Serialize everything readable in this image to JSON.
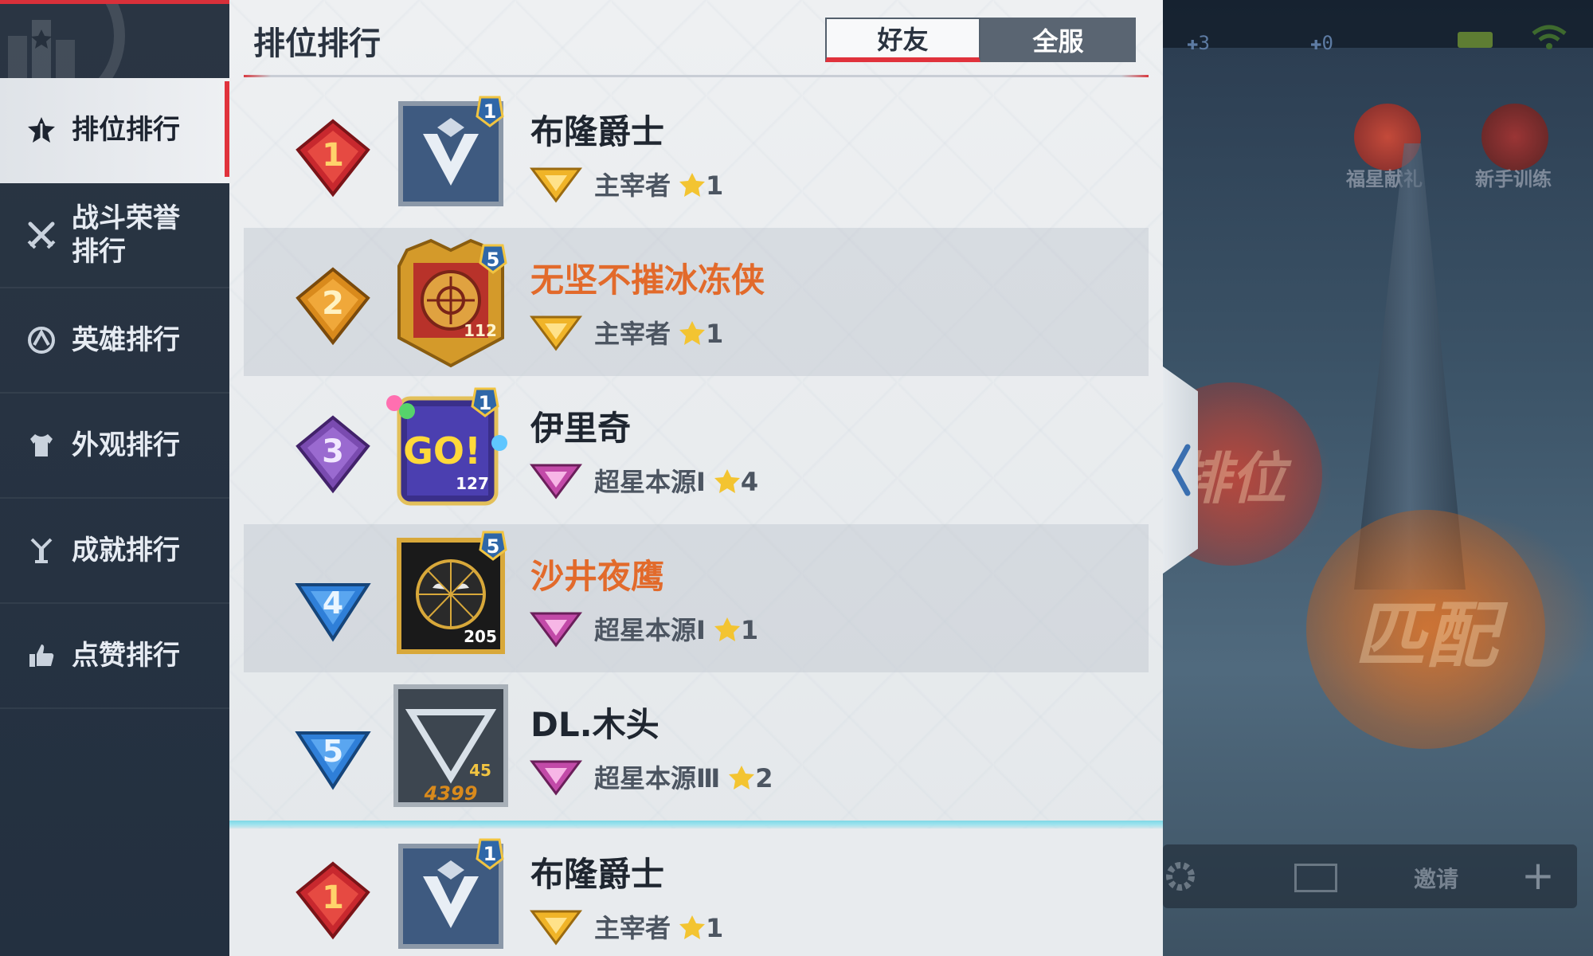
{
  "sidebar": {
    "items": [
      {
        "label": "排位排行",
        "icon": "star-rank-icon",
        "active": true
      },
      {
        "label": "战斗荣誉排行",
        "icon": "crossed-swords-icon",
        "active": false
      },
      {
        "label": "英雄排行",
        "icon": "hero-emblem-icon",
        "active": false
      },
      {
        "label": "外观排行",
        "icon": "shirt-icon",
        "active": false
      },
      {
        "label": "成就排行",
        "icon": "trophy-icon",
        "active": false
      },
      {
        "label": "点赞排行",
        "icon": "thumbs-up-icon",
        "active": false
      }
    ]
  },
  "panel": {
    "title": "排位排行",
    "tabs": [
      {
        "label": "好友",
        "active": true
      },
      {
        "label": "全服",
        "active": false
      }
    ]
  },
  "rankings": [
    {
      "rank": "1",
      "name": "布隆爵士",
      "name_highlight": false,
      "tier": "主宰者",
      "stars": "1",
      "avatar_badge": "1",
      "avatar_level": "",
      "avatar_style": "silver-v"
    },
    {
      "rank": "2",
      "name": "无坚不摧冰冻侠",
      "name_highlight": true,
      "tier": "主宰者",
      "stars": "1",
      "avatar_badge": "5",
      "avatar_level": "112",
      "avatar_style": "gold-crest"
    },
    {
      "rank": "3",
      "name": "伊里奇",
      "name_highlight": false,
      "tier": "超星本源Ⅰ",
      "stars": "4",
      "avatar_badge": "1",
      "avatar_level": "127",
      "avatar_style": "go-balloons"
    },
    {
      "rank": "4",
      "name": "沙井夜鹰",
      "name_highlight": true,
      "tier": "超星本源Ⅰ",
      "stars": "1",
      "avatar_badge": "5",
      "avatar_level": "205",
      "avatar_style": "spider-gold"
    },
    {
      "rank": "5",
      "name": "DL.木头",
      "name_highlight": false,
      "tier": "超星本源Ⅲ",
      "stars": "2",
      "avatar_badge": "",
      "avatar_level": "45",
      "avatar_style": "silver-triangle",
      "avatar_caption": "4399"
    }
  ],
  "self_row": {
    "rank": "1",
    "name": "布隆爵士",
    "tier": "主宰者",
    "stars": "1",
    "avatar_badge": "1"
  },
  "background": {
    "top_counters": [
      "3",
      "0"
    ],
    "event_labels": [
      "福星献礼",
      "新手训练"
    ],
    "mode_labels": [
      "排位",
      "匹配"
    ],
    "invite_label": "邀请"
  },
  "colors": {
    "accent_red": "#e0323c",
    "name_orange": "#e26a2b",
    "rank1": "#c8282e",
    "rank2": "#d98a1c",
    "rank3": "#7a4bb0",
    "rank45": "#2f7fd8",
    "star": "#f3c431"
  }
}
